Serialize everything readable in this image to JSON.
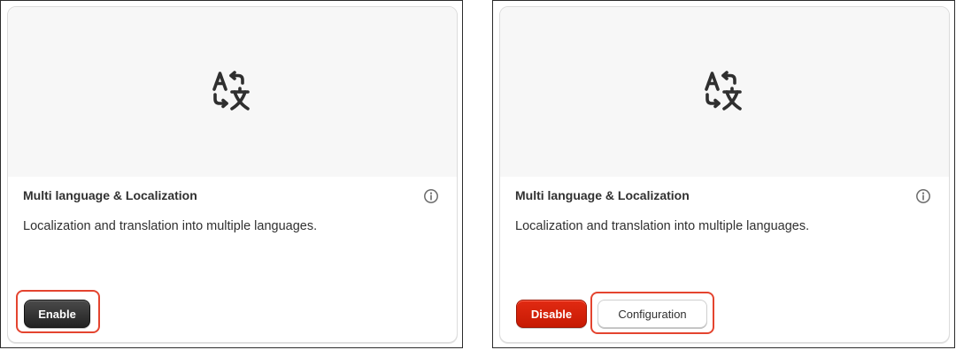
{
  "cards": [
    {
      "title": "Multi language & Localization",
      "description": "Localization and translation into multiple languages.",
      "buttons": {
        "enable": "Enable"
      }
    },
    {
      "title": "Multi language & Localization",
      "description": "Localization and translation into multiple languages.",
      "buttons": {
        "disable": "Disable",
        "configuration": "Configuration"
      }
    }
  ],
  "icons": {
    "hero": "translate-icon",
    "info": "info-icon"
  },
  "colors": {
    "highlight": "#e4442f",
    "enable_button": "#303030",
    "disable_button": "#d21f08"
  }
}
